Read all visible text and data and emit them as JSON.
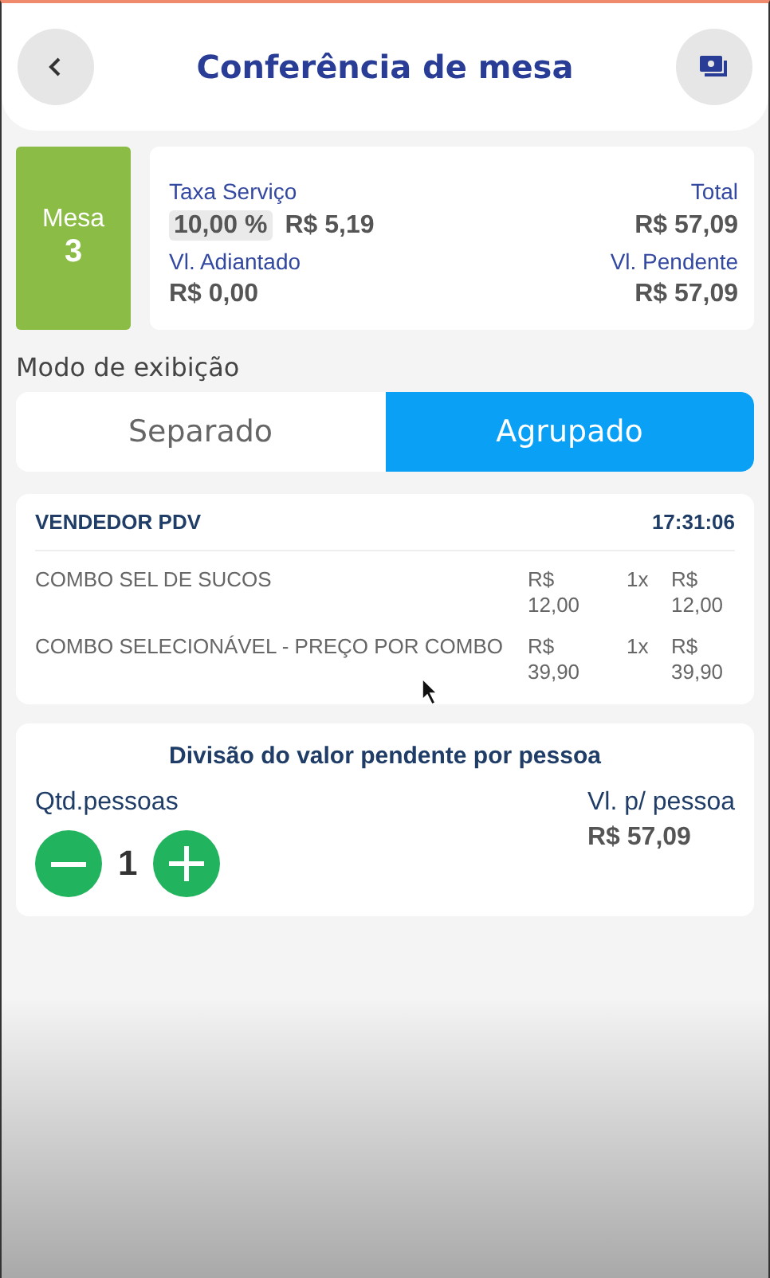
{
  "header": {
    "title": "Conferência de mesa"
  },
  "table": {
    "label": "Mesa",
    "number": "3"
  },
  "summary": {
    "service_label": "Taxa Serviço",
    "service_rate": "10,00 %",
    "service_value": "R$ 5,19",
    "total_label": "Total",
    "total_value": "R$ 57,09",
    "advance_label": "Vl. Adiantado",
    "advance_value": "R$ 0,00",
    "pending_label": "Vl. Pendente",
    "pending_value": "R$ 57,09"
  },
  "display_mode": {
    "label": "Modo de exibição",
    "options": [
      {
        "label": "Separado",
        "selected": false
      },
      {
        "label": "Agrupado",
        "selected": true
      }
    ]
  },
  "order": {
    "seller": "VENDEDOR PDV",
    "time": "17:31:06",
    "items": [
      {
        "name": "COMBO SEL DE SUCOS",
        "price": "R$ 12,00",
        "qty": "1x",
        "total": "R$ 12,00"
      },
      {
        "name": "COMBO SELECIONÁVEL - PREÇO POR COMBO",
        "price": "R$ 39,90",
        "qty": "1x",
        "total": "R$ 39,90"
      }
    ]
  },
  "split": {
    "title": "Divisão do valor pendente por pessoa",
    "people_label": "Qtd.pessoas",
    "people_count": "1",
    "per_person_label": "Vl. p/ pessoa",
    "per_person_value": "R$ 57,09"
  }
}
